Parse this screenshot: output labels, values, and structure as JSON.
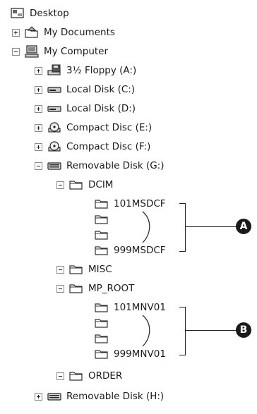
{
  "tree": {
    "desktop": "Desktop",
    "my_documents": "My Documents",
    "my_computer": "My Computer",
    "floppy": "3½ Floppy (A:)",
    "local_c": "Local Disk (C:)",
    "local_d": "Local Disk (D:)",
    "cd_e": "Compact Disc (E:)",
    "cd_f": "Compact Disc (F:)",
    "removable_g": "Removable Disk (G:)",
    "dcim": "DCIM",
    "msdcf_first": "101MSDCF",
    "msdcf_last": "999MSDCF",
    "misc": "MISC",
    "mp_root": "MP_ROOT",
    "mnv_first": "101MNV01",
    "mnv_last": "999MNV01",
    "order": "ORDER",
    "removable_h": "Removable Disk (H:)"
  },
  "callouts": {
    "a": "A",
    "b": "B"
  }
}
